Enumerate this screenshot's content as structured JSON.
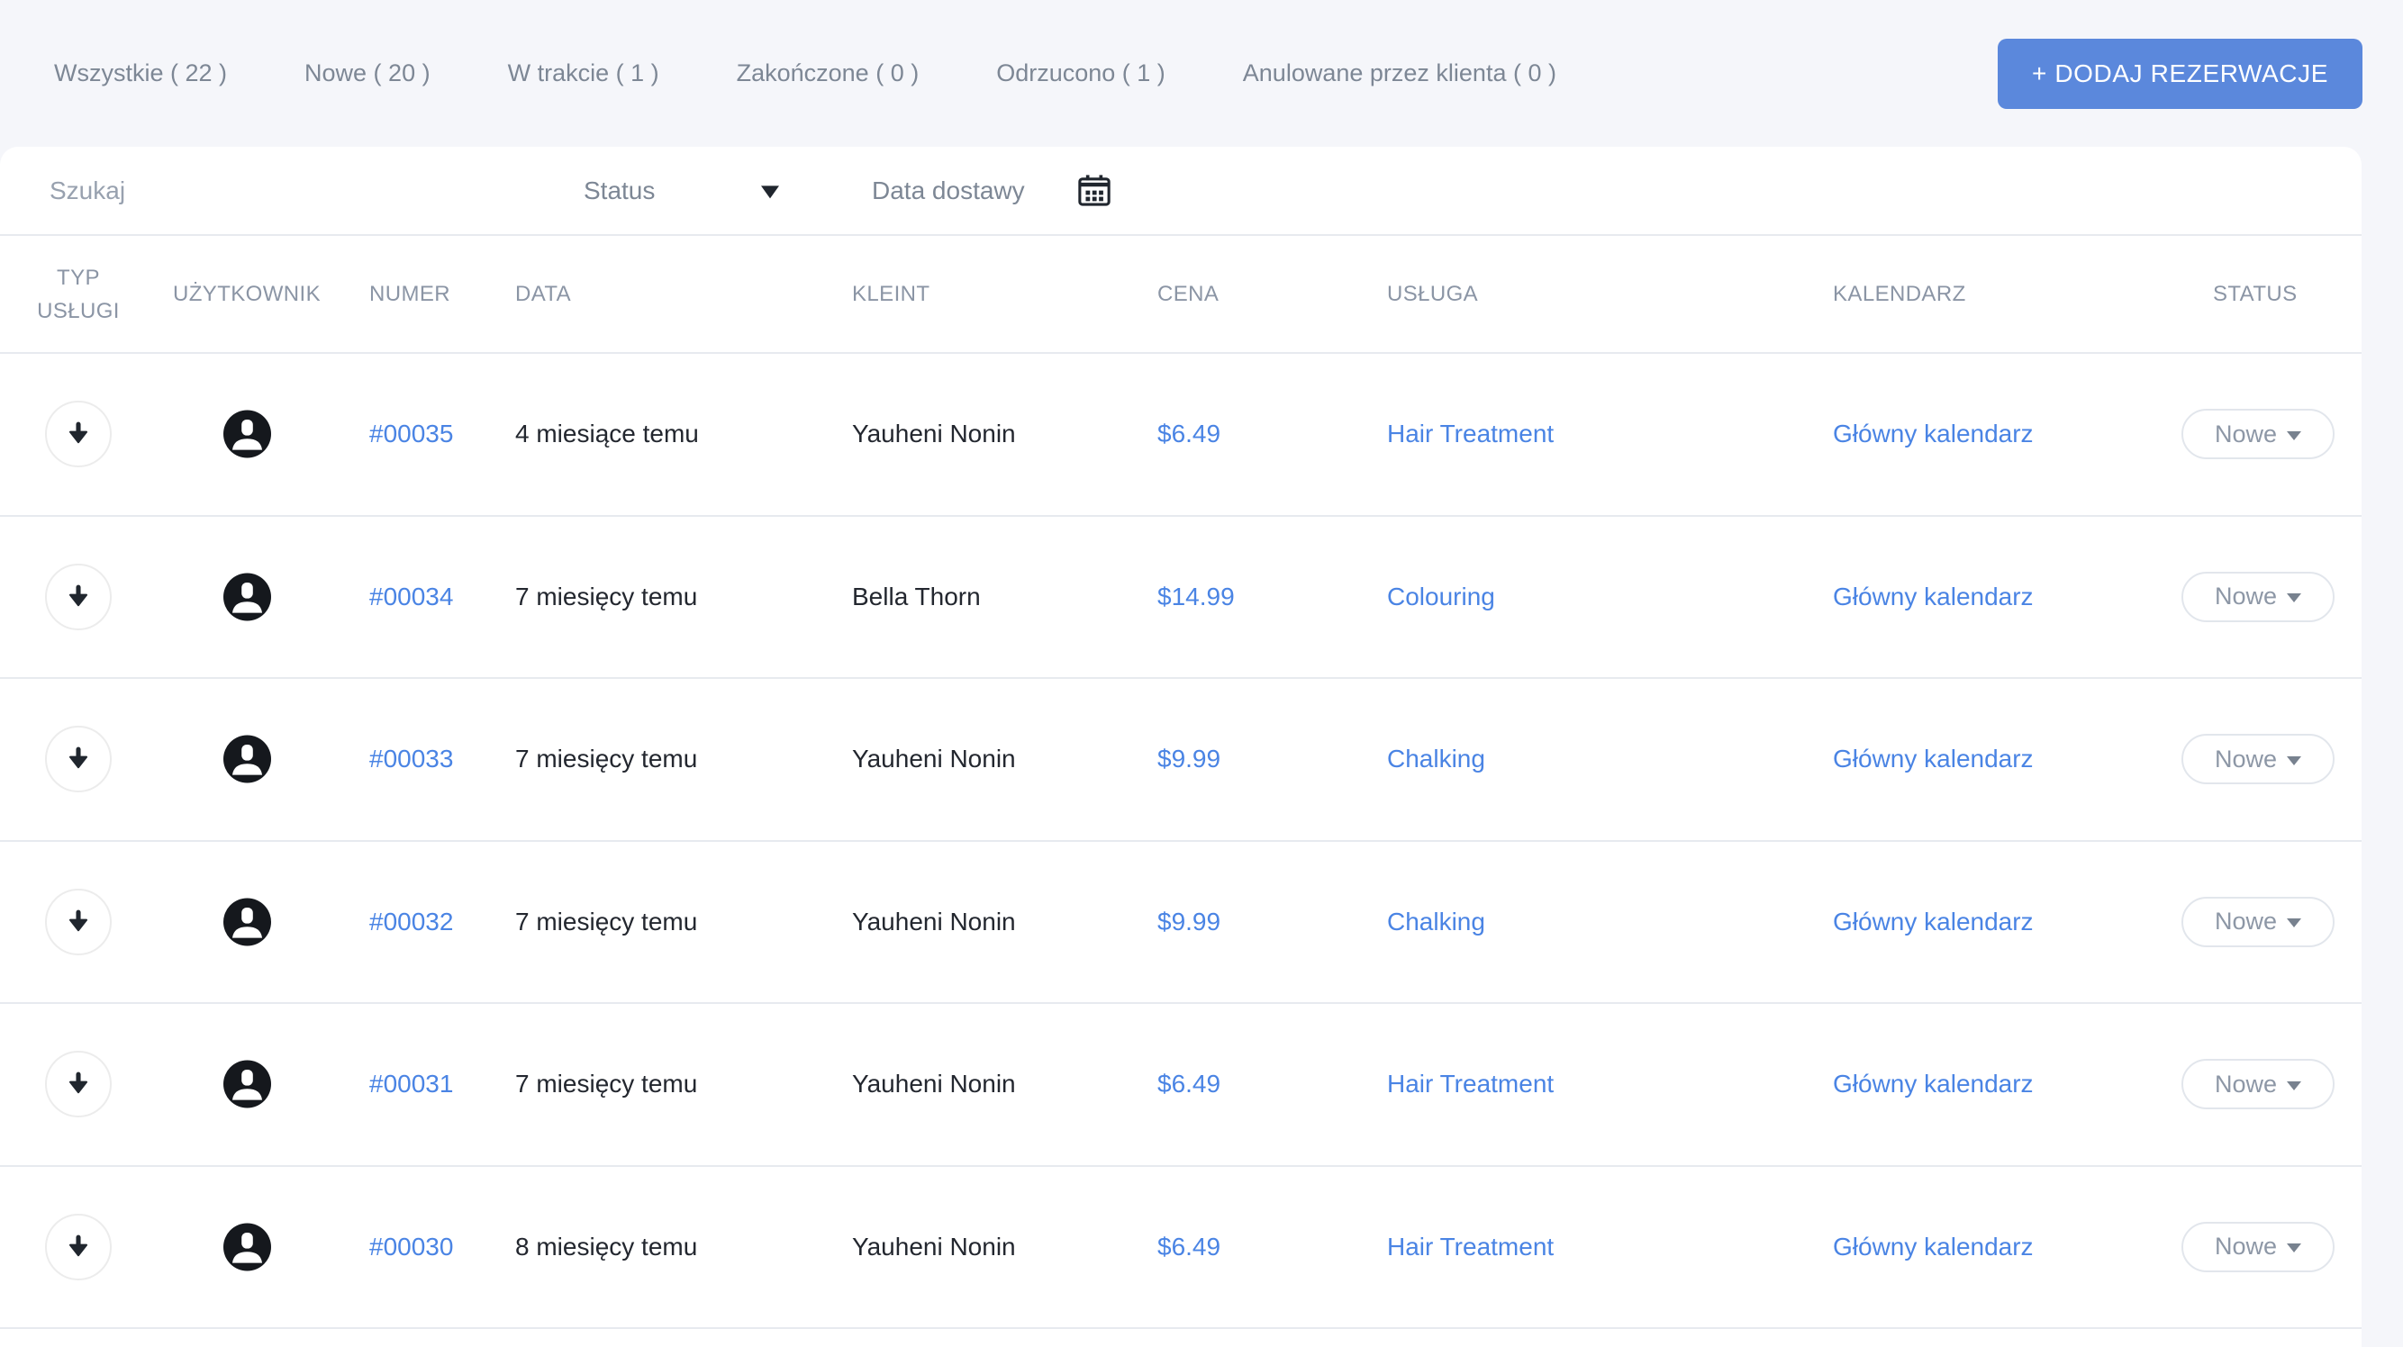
{
  "colors": {
    "background": "#f5f6fa",
    "accent_blue": "#5b88dc",
    "link_blue": "#4a84e4",
    "text_dark": "#23272f",
    "text_gray": "#7d8795",
    "header_gray": "#8b95a5",
    "row_border": "#e7eaef"
  },
  "tabs": [
    {
      "label": "Wszystkie ( 22 )"
    },
    {
      "label": "Nowe ( 20 )"
    },
    {
      "label": "W trakcie ( 1 )"
    },
    {
      "label": "Zakończone ( 0 )"
    },
    {
      "label": "Odrzucono ( 1 )"
    },
    {
      "label": "Anulowane przez klienta ( 0 )"
    }
  ],
  "toolbar": {
    "add_button_label": "+ DODAJ REZERWACJE"
  },
  "filters": {
    "search_placeholder": "Szukaj",
    "status_label": "Status",
    "date_label": "Data dostawy"
  },
  "table": {
    "headers": {
      "type": "TYP USŁUGI",
      "user": "UŻYTKOWNIK",
      "number": "NUMER",
      "date": "DATA",
      "client": "KLEINT",
      "price": "CENA",
      "service": "USŁUGA",
      "calendar": "KALENDARZ",
      "status": "STATUS"
    },
    "rows": [
      {
        "number": "#00035",
        "date": "4 miesiące temu",
        "client": "Yauheni Nonin",
        "price": "$6.49",
        "service": "Hair Treatment",
        "calendar": "Główny kalendarz",
        "status": "Nowe"
      },
      {
        "number": "#00034",
        "date": "7 miesięcy temu",
        "client": "Bella Thorn",
        "price": "$14.99",
        "service": "Colouring",
        "calendar": "Główny kalendarz",
        "status": "Nowe"
      },
      {
        "number": "#00033",
        "date": "7 miesięcy temu",
        "client": "Yauheni Nonin",
        "price": "$9.99",
        "service": "Chalking",
        "calendar": "Główny kalendarz",
        "status": "Nowe"
      },
      {
        "number": "#00032",
        "date": "7 miesięcy temu",
        "client": "Yauheni Nonin",
        "price": "$9.99",
        "service": "Chalking",
        "calendar": "Główny kalendarz",
        "status": "Nowe"
      },
      {
        "number": "#00031",
        "date": "7 miesięcy temu",
        "client": "Yauheni Nonin",
        "price": "$6.49",
        "service": "Hair Treatment",
        "calendar": "Główny kalendarz",
        "status": "Nowe"
      },
      {
        "number": "#00030",
        "date": "8 miesięcy temu",
        "client": "Yauheni Nonin",
        "price": "$6.49",
        "service": "Hair Treatment",
        "calendar": "Główny kalendarz",
        "status": "Nowe"
      }
    ]
  }
}
